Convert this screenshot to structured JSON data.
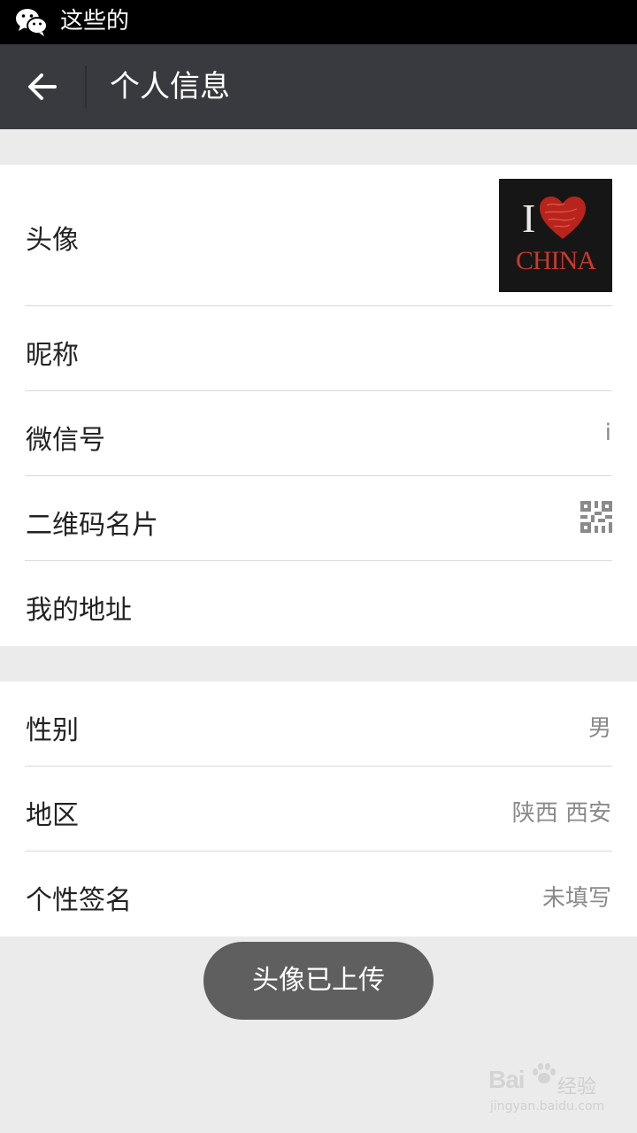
{
  "status_bar": {
    "app_icon": "wechat-icon",
    "text": "这些的"
  },
  "header": {
    "back_icon": "arrow-left-icon",
    "title": "个人信息"
  },
  "profile": {
    "avatar": {
      "label": "头像",
      "image_text_top": "I",
      "image_text_bottom": "CHINA"
    },
    "nickname": {
      "label": "昵称",
      "value": ""
    },
    "wechat_id": {
      "label": "微信号",
      "value": "i"
    },
    "qr_card": {
      "label": "二维码名片",
      "icon": "qr-code-icon"
    },
    "address": {
      "label": "我的地址"
    }
  },
  "details": {
    "gender": {
      "label": "性别",
      "value": "男"
    },
    "region": {
      "label": "地区",
      "value": "陕西 西安"
    },
    "signature": {
      "label": "个性签名",
      "value": "未填写"
    }
  },
  "toast": {
    "text": "头像已上传"
  },
  "watermark": {
    "brand": "Bai",
    "brand_cn": "经验",
    "url": "jingyan.baidu.com"
  },
  "colors": {
    "title_bar": "#393a3f",
    "status_bar": "#000000",
    "background": "#ebebeb",
    "toast": "#5f5f5f"
  }
}
